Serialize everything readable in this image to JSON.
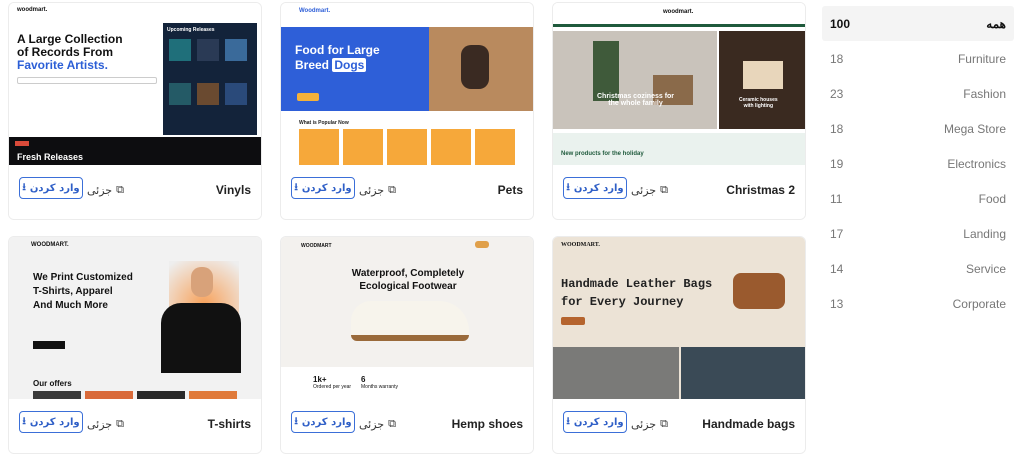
{
  "cards": [
    {
      "title": "Vinyls",
      "detail": "جزئی",
      "enter": "وارد کردن",
      "preview": {
        "logo": "woodmart.",
        "headline1": "A Large Collection",
        "headline2": "of Records From",
        "headline3": "Favorite Artists.",
        "panel": "Upcoming Releases",
        "strip": "Fresh Releases"
      }
    },
    {
      "title": "Pets",
      "detail": "جزئی",
      "enter": "وارد کردن",
      "preview": {
        "logo": "Woodmart.",
        "headline1": "Food for Large",
        "headline2": "Breed",
        "highlight": "Dogs",
        "section": "What is Popular Now"
      }
    },
    {
      "title": "Christmas 2",
      "detail": "جزئی",
      "enter": "وارد کردن",
      "preview": {
        "logo": "woodmart.",
        "banner1a": "Christmas coziness for",
        "banner1b": "the whole family",
        "banner2a": "Ceramic houses",
        "banner2b": "with lighting",
        "section": "New products for the holiday"
      }
    },
    {
      "title": "T-shirts",
      "detail": "جزئی",
      "enter": "وارد کردن",
      "preview": {
        "logo": "WOODMART.",
        "headline1": "We Print Customized",
        "headline2": "T-Shirts, Apparel",
        "headline3": "And Much More",
        "section": "Our offers"
      }
    },
    {
      "title": "Hemp shoes",
      "detail": "جزئی",
      "enter": "وارد کردن",
      "preview": {
        "logo": "WOODMART",
        "headline1": "Waterproof, Completely",
        "headline2": "Ecological Footwear",
        "stat1": "1k+",
        "stat1label": "Ordered per year",
        "stat2": "6",
        "stat2label": "Months warranty"
      }
    },
    {
      "title": "Handmade bags",
      "detail": "جزئی",
      "enter": "وارد کردن",
      "preview": {
        "logo": "WOODMART.",
        "headline1": "Handmade Leather Bags",
        "headline2": "for Every Journey"
      }
    }
  ],
  "sidebar": [
    {
      "count": "100",
      "label": "همه",
      "active": true
    },
    {
      "count": "18",
      "label": "Furniture"
    },
    {
      "count": "23",
      "label": "Fashion"
    },
    {
      "count": "18",
      "label": "Mega Store"
    },
    {
      "count": "19",
      "label": "Electronics"
    },
    {
      "count": "11",
      "label": "Food"
    },
    {
      "count": "17",
      "label": "Landing"
    },
    {
      "count": "14",
      "label": "Service"
    },
    {
      "count": "13",
      "label": "Corporate"
    }
  ],
  "colors": {
    "accent": "#3b6fd8",
    "pets_blue": "#2e5fd8",
    "xmas_green": "#1f5a3c",
    "bags_beige": "#ece3d6"
  }
}
